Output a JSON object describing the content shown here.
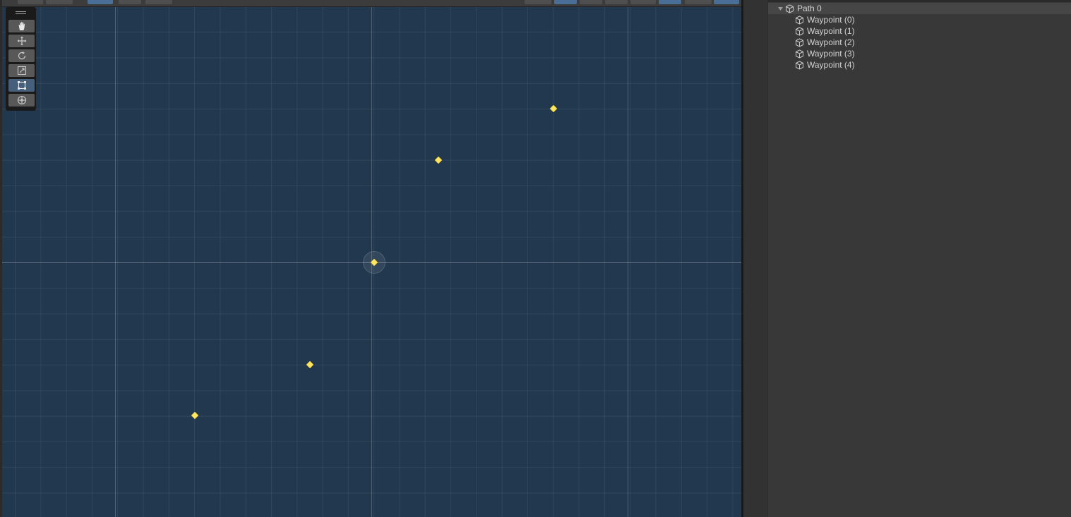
{
  "hierarchy": {
    "root": {
      "label": "Path 0",
      "expanded": true
    },
    "children": [
      {
        "label": "Waypoint (0)"
      },
      {
        "label": "Waypoint (1)"
      },
      {
        "label": "Waypoint (2)"
      },
      {
        "label": "Waypoint (3)"
      },
      {
        "label": "Waypoint (4)"
      }
    ]
  },
  "scene": {
    "tools": [
      {
        "name": "hand-tool",
        "icon": "hand-icon",
        "active": false
      },
      {
        "name": "move-tool",
        "icon": "move-icon",
        "active": false
      },
      {
        "name": "rotate-tool",
        "icon": "rotate-icon",
        "active": false
      },
      {
        "name": "scale-tool",
        "icon": "scale-icon",
        "active": false
      },
      {
        "name": "rect-tool",
        "icon": "rect-icon",
        "active": true
      },
      {
        "name": "transform-tool",
        "icon": "transform-icon",
        "active": false
      }
    ],
    "waypoint_color": "#ffe761",
    "background_color": "#22384f"
  }
}
